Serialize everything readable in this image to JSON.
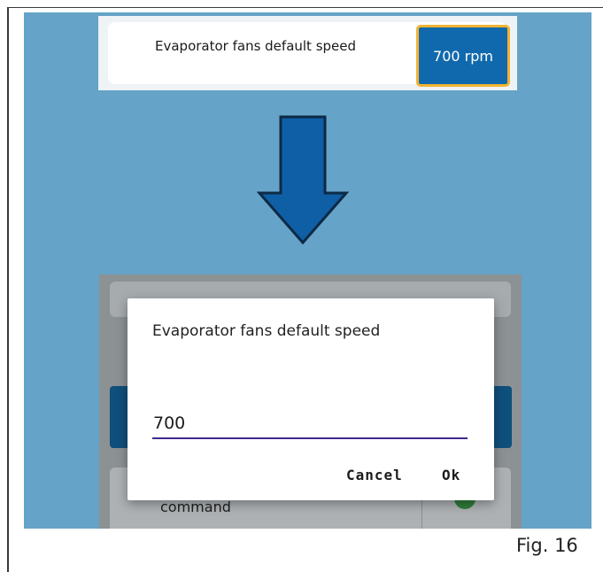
{
  "setting": {
    "label": "Evaporator fans default speed",
    "value": "700 rpm"
  },
  "arrow": {
    "icon": "down-arrow-icon",
    "fill": "#0f5fa6",
    "stroke": "#0c2a45"
  },
  "background_app": {
    "row_label": "command"
  },
  "dialog": {
    "title": "Evaporator fans default speed",
    "input_value": "700",
    "cancel_label": "Cancel",
    "ok_label": "Ok"
  },
  "figure": {
    "caption": "Fig. 16"
  },
  "colors": {
    "panel_bg": "#65a3c8",
    "value_button": "#1169ad",
    "value_button_border": "#f2b331",
    "input_underline": "#3f2a8c"
  }
}
